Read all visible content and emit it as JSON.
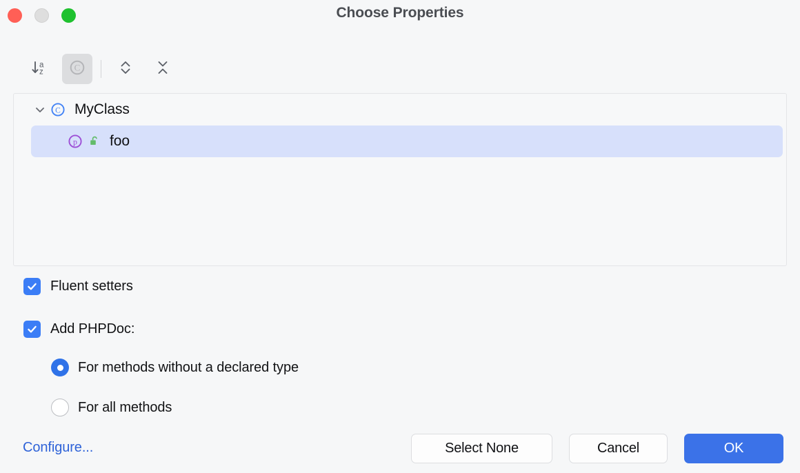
{
  "window": {
    "title": "Choose Properties",
    "traffic_lights": [
      {
        "name": "close",
        "color": "#ff5f56"
      },
      {
        "name": "minimize",
        "color": "#dedede"
      },
      {
        "name": "zoom",
        "color": "#1fc12f"
      }
    ]
  },
  "toolbar": {
    "buttons": [
      {
        "name": "sort-alphabetically",
        "icon": "sort-az-icon",
        "pressed": false
      },
      {
        "name": "group-by-class",
        "icon": "class-circle-icon",
        "pressed": true
      },
      {
        "name": "expand-all",
        "icon": "expand-all-icon",
        "pressed": false
      },
      {
        "name": "collapse-all",
        "icon": "collapse-all-icon",
        "pressed": false
      }
    ]
  },
  "tree": {
    "root": {
      "label": "MyClass",
      "icon": "class-icon",
      "expanded": true,
      "chevron": "chevron-down-icon"
    },
    "child": {
      "label": "foo",
      "icon": "property-icon",
      "visibility_icon": "public-unlocked-icon",
      "selected": true
    }
  },
  "options": {
    "fluent_setters": {
      "label": "Fluent setters",
      "checked": true
    },
    "add_phpdoc": {
      "label": "Add PHPDoc:",
      "checked": true
    },
    "phpdoc_mode": {
      "selected": "for-methods-without-declared-type",
      "choices": [
        {
          "id": "for-methods-without-declared-type",
          "label": "For methods without a declared type",
          "selected": true
        },
        {
          "id": "for-all-methods",
          "label": "For all methods",
          "selected": false
        }
      ]
    }
  },
  "footer": {
    "configure_label": "Configure...",
    "select_none_label": "Select None",
    "cancel_label": "Cancel",
    "ok_label": "OK"
  },
  "colors": {
    "accent": "#3b72e8",
    "checkbox": "#3b7df6",
    "selection": "#d7e0fb",
    "link": "#2f63d8",
    "background": "#f6f7f8",
    "class_icon": "#4383f5",
    "property_icon": "#9d4fd6",
    "lock_icon": "#63bc6a"
  }
}
